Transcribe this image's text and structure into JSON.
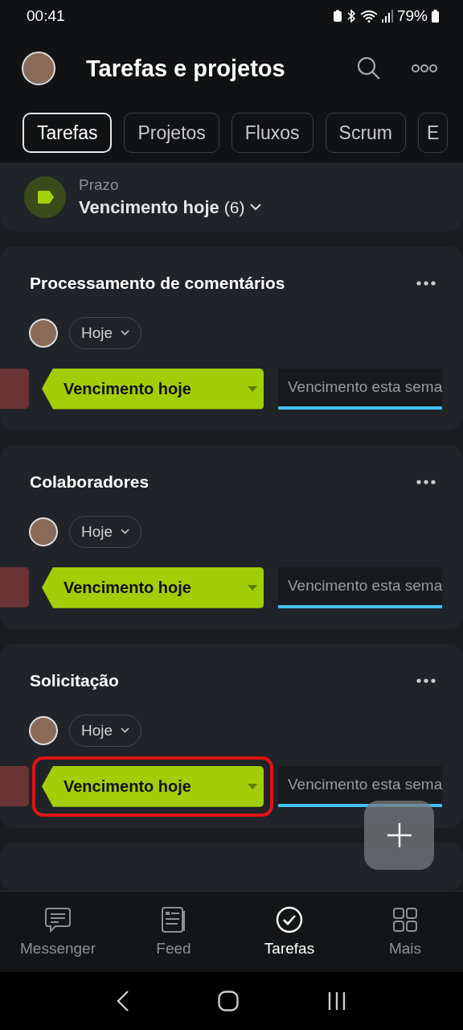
{
  "status_bar": {
    "time": "00:41",
    "battery": "79%"
  },
  "header": {
    "title": "Tarefas e projetos"
  },
  "tabs": [
    {
      "label": "Tarefas",
      "selected": true
    },
    {
      "label": "Projetos",
      "selected": false
    },
    {
      "label": "Fluxos",
      "selected": false
    },
    {
      "label": "Scrum",
      "selected": false
    },
    {
      "label": "E",
      "selected": false
    }
  ],
  "filter": {
    "label": "Prazo",
    "value": "Vencimento hoje",
    "count": "(6)"
  },
  "tasks": [
    {
      "title": "Processamento de comentários",
      "deadline": "Hoje",
      "stage": "Vencimento hoje",
      "next_stage": "Vencimento esta sema",
      "highlighted": false
    },
    {
      "title": "Colaboradores",
      "deadline": "Hoje",
      "stage": "Vencimento hoje",
      "next_stage": "Vencimento esta sema",
      "highlighted": false
    },
    {
      "title": "Solicitação",
      "deadline": "Hoje",
      "stage": "Vencimento hoje",
      "next_stage": "Vencimento esta sema",
      "highlighted": true
    }
  ],
  "bottom_nav": [
    {
      "label": "Messenger",
      "kind": "chat",
      "selected": false
    },
    {
      "label": "Feed",
      "kind": "feed",
      "selected": false
    },
    {
      "label": "Tarefas",
      "kind": "check",
      "selected": true
    },
    {
      "label": "Mais",
      "kind": "grid",
      "selected": false
    }
  ]
}
